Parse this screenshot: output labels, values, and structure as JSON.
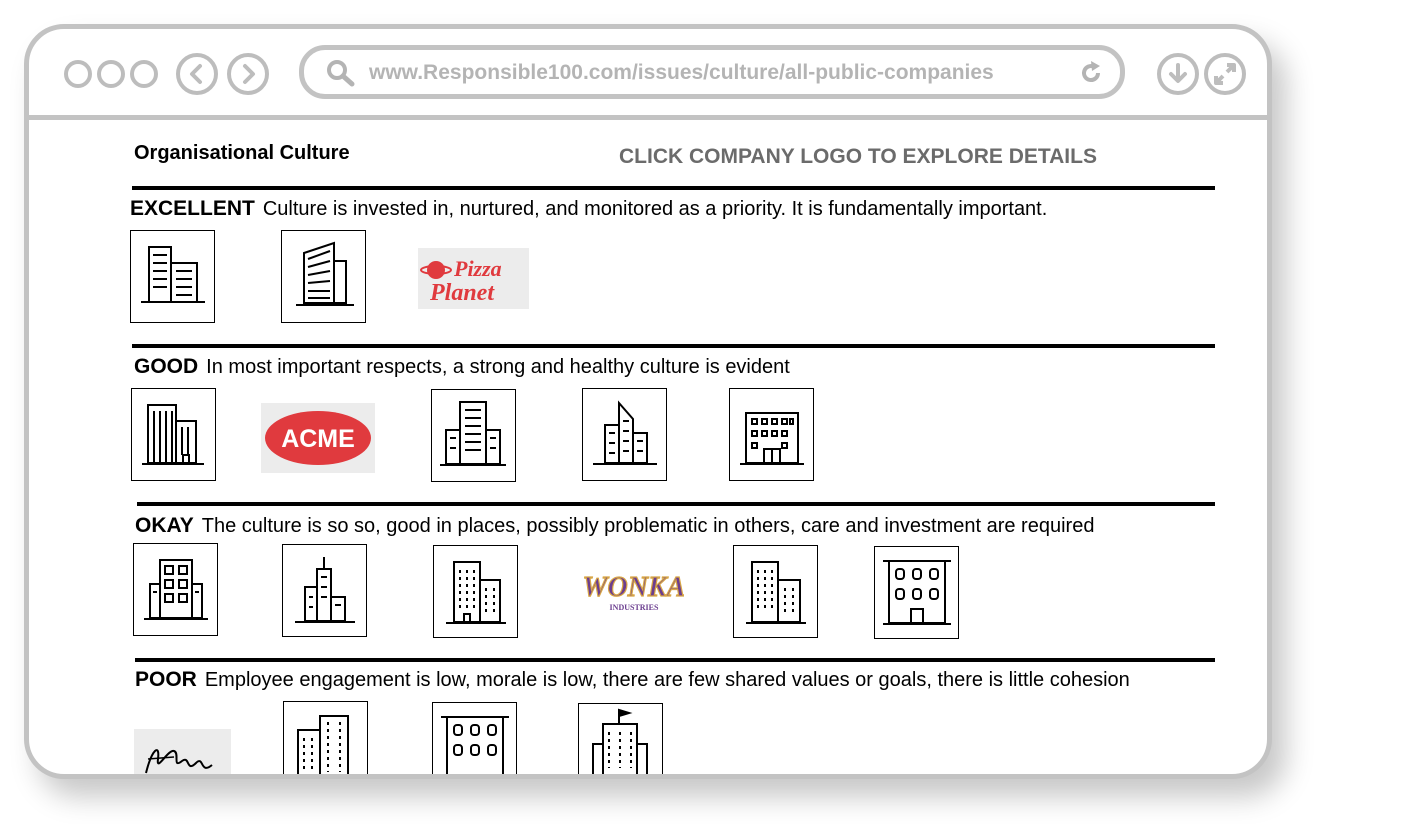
{
  "browser": {
    "url": "www.Responsible100.com/issues/culture/all-public-companies",
    "window_buttons": [
      "window-dot-icon",
      "window-dot-icon",
      "window-dot-icon"
    ],
    "nav_icons": [
      "back-arrow-icon",
      "forward-arrow-icon"
    ],
    "address_icons": [
      "search-icon",
      "reload-icon"
    ],
    "right_icons": [
      "download-icon",
      "fullscreen-icon"
    ]
  },
  "page": {
    "title": "Organisational Culture",
    "instruction": "CLICK COMPANY LOGO TO EXPLORE DETAILS"
  },
  "sections": [
    {
      "level": "EXCELLENT",
      "description": "Culture is invested in, nurtured, and monitored as a priority. It is fundamentally important.",
      "logos": [
        "building-logo-icon",
        "building-logo-icon",
        "pizza-planet-logo"
      ]
    },
    {
      "level": "GOOD",
      "description": "In most important respects, a strong and healthy culture is evident",
      "logos": [
        "building-logo-icon",
        "acme-logo",
        "building-logo-icon",
        "building-logo-icon",
        "building-logo-icon"
      ]
    },
    {
      "level": "OKAY",
      "description": "The culture is so so, good in places, possibly problematic in others, care and investment are required",
      "logos": [
        "building-logo-icon",
        "building-logo-icon",
        "building-logo-icon",
        "wonka-industries-logo",
        "building-logo-icon",
        "building-logo-icon"
      ]
    },
    {
      "level": "POOR",
      "description": "Employee engagement is low, morale is low, there are few shared values or goals, there is little cohesion",
      "logos": [
        "signature-logo",
        "building-logo-icon",
        "building-logo-icon",
        "building-logo-icon"
      ]
    }
  ],
  "brand_logos": {
    "pizza_planet": "Pizza Planet",
    "acme": "ACME",
    "wonka": "WONKA",
    "wonka_sub": "INDUSTRIES",
    "signature": "signature"
  },
  "colors": {
    "frame": "#c3c3c3",
    "pizza_red": "#e03a3e",
    "acme_red": "#e03a3e",
    "wonka_purple": "#6b3d8f",
    "wonka_gold": "#d8a646",
    "instruction_gray": "#6b6b6b"
  }
}
